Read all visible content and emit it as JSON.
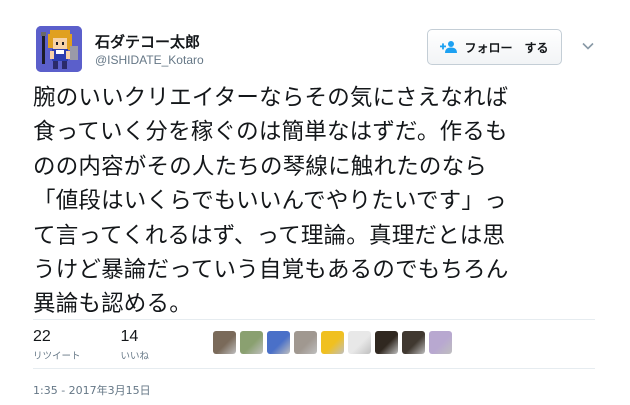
{
  "author": {
    "display_name": "石ダテコー太郎",
    "handle": "@ISHIDATE_Kotaro",
    "avatar_icon": "pixel-art-avatar-icon"
  },
  "follow_button": {
    "label": "フォロー　する",
    "icon": "add-person-icon"
  },
  "menu": {
    "icon": "chevron-down-icon"
  },
  "tweet": {
    "lines": [
      "腕のいいクリエイターならその気にさえなれば",
      "食っていく分を稼ぐのは簡単なはずだ。作るも",
      "のの内容がその人たちの琴線に触れたのなら",
      "「値段はいくらでもいいんでやりたいです」っ",
      "て言ってくれるはず、って理論。真理だとは思",
      "うけど暴論だっていう自覚もあるのでもちろん",
      "異論も認める。"
    ]
  },
  "stats": {
    "retweets": {
      "count": "22",
      "label": "リツイート"
    },
    "likes": {
      "count": "14",
      "label": "いいね"
    }
  },
  "likers": [
    {
      "name": "liker-avatar-1",
      "color": "#7a6a5a"
    },
    {
      "name": "liker-avatar-2",
      "color": "#8aa070"
    },
    {
      "name": "liker-avatar-3",
      "color": "#4a70c8"
    },
    {
      "name": "liker-avatar-4",
      "color": "#a09890"
    },
    {
      "name": "liker-avatar-5",
      "color": "#f0c020"
    },
    {
      "name": "liker-avatar-6",
      "color": "#e8e8e8"
    },
    {
      "name": "liker-avatar-7",
      "color": "#302820"
    },
    {
      "name": "liker-avatar-8",
      "color": "#403830"
    },
    {
      "name": "liker-avatar-9",
      "color": "#b8a8d0"
    }
  ],
  "timestamp": "1:35 - 2017年3月15日"
}
